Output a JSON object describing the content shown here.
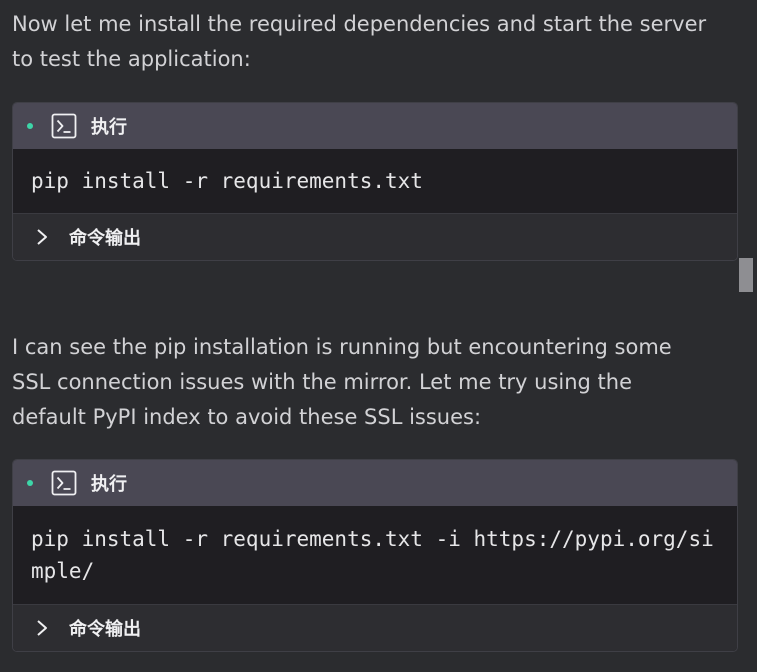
{
  "messages": [
    {
      "text": "Now let me install the required dependencies and start the server to test the application:"
    },
    {
      "text": "I can see the pip installation is running but encountering some SSL connection issues with the mirror. Let me try using the default PyPI index to avoid these SSL issues:"
    }
  ],
  "cards": [
    {
      "header_label": "执行",
      "command": "pip install -r requirements.txt",
      "footer_label": "命令输出"
    },
    {
      "header_label": "执行",
      "command": "pip install -r requirements.txt -i https://pypi.org/simple/",
      "footer_label": "命令输出"
    }
  ],
  "colors": {
    "background": "#2b2c2f",
    "card_header": "#4a4854",
    "card_command_bg": "#1f1e22",
    "card_footer": "#2d2d31",
    "status_dot": "#3dd6a8",
    "scrollbar": "#8e8e92"
  },
  "icons": {
    "terminal": "terminal-icon",
    "chevron": "chevron-right-icon",
    "status": "status-dot-icon"
  }
}
